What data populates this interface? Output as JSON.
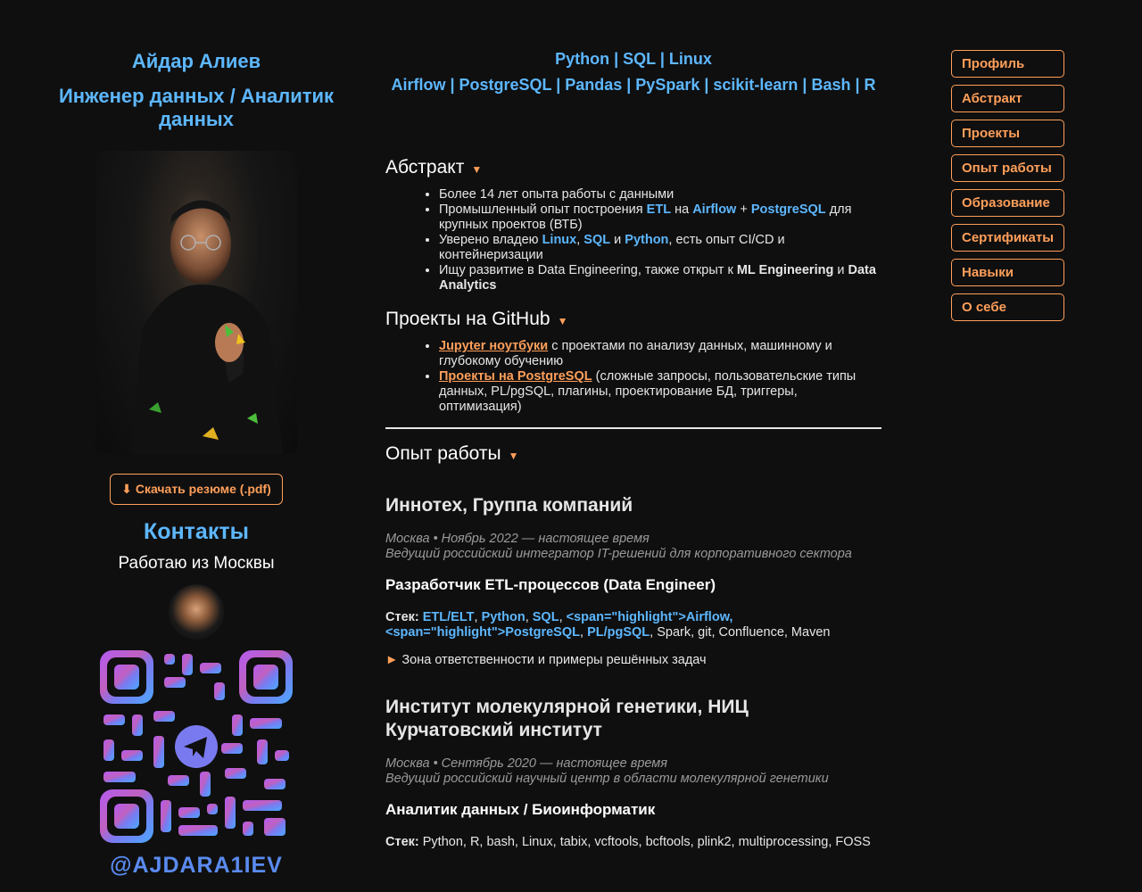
{
  "profile": {
    "name": "Айдар Алиев",
    "role": "Инженер данных / Аналитик данных",
    "resume_button": "⬇ Скачать резюме (.pdf)",
    "contacts_title": "Контакты",
    "location": "Работаю из Москвы",
    "telegram_handle": "@AJDARA1IEV"
  },
  "tech": {
    "line1": "Python | SQL | Linux",
    "line2": "Airflow | PostgreSQL | Pandas | PySpark | scikit-learn | Bash | R"
  },
  "sections": {
    "abstract_title": "Абстракт",
    "projects_title": "Проекты на GitHub",
    "experience_title": "Опыт работы",
    "caret": "▼"
  },
  "abstract": {
    "b1": "Более 14 лет опыта работы с данными",
    "b2_pre": "Промышленный опыт построения ",
    "b2_etl": "ETL",
    "b2_mid1": " на ",
    "b2_airflow": "Airflow",
    "b2_plus": " + ",
    "b2_pg": "PostgreSQL",
    "b2_post": " для крупных проектов (ВТБ)",
    "b3_pre": "Уверено владею ",
    "b3_linux": "Linux",
    "b3_c1": ", ",
    "b3_sql": "SQL",
    "b3_and": " и ",
    "b3_python": "Python",
    "b3_post": ", есть опыт CI/CD и контейнеризации",
    "b4_pre": "Ищу развитие в Data Engineering, также открыт к ",
    "b4_ml": "ML Engineering",
    "b4_and": " и ",
    "b4_da": "Data Analytics"
  },
  "projects": {
    "p1_link": "Jupyter ноутбуки",
    "p1_text": " с проектами по анализу данных, машинному и глубокому обучению",
    "p2_link": "Проекты на PostgreSQL",
    "p2_text": " (сложные запросы, пользовательские типы данных, PL/pgSQL, плагины, проектирование БД, триггеры, оптимизация)"
  },
  "jobs": [
    {
      "company": "Иннотех, Группа компаний",
      "meta1": "Москва • Ноябрь 2022 — настоящее время",
      "meta2": "Ведущий российский интегратор IT-решений для корпоративного сектора",
      "position": "Разработчик ETL-процессов (Data Engineer)",
      "stack_label": "Стек:",
      "stack_hl1": "ETL/ELT",
      "stack_c1": ", ",
      "stack_hl2": "Python",
      "stack_c2": ", ",
      "stack_hl3": "SQL",
      "stack_c3": ", ",
      "stack_hl4": "<span=\"highlight\">Airflow, <span=\"highlight\">PostgreSQL",
      "stack_c4": ", ",
      "stack_hl5": "PL/pgSQL",
      "stack_rest": ", Spark, git, Confluence, Maven",
      "toggle": "Зона ответственности и примеры решённых задач"
    },
    {
      "company": "Институт молекулярной генетики, НИЦ Курчатовский институт",
      "meta1": "Москва • Сентябрь 2020 — настоящее время",
      "meta2": "Ведущий российский научный центр в области молекулярной генетики",
      "position": "Аналитик данных / Биоинформатик",
      "stack_label": "Стек:",
      "stack_rest": " Python, R, bash, Linux, tabix, vcftools, bcftools, plink2, multiprocessing, FOSS"
    }
  ],
  "nav": [
    "Профиль",
    "Абстракт",
    "Проекты",
    "Опыт работы",
    "Образование",
    "Сертификаты",
    "Навыки",
    "О себе"
  ],
  "colors": {
    "accent_blue": "#5db7ff",
    "accent_orange": "#ff9f5a",
    "background": "#0f0f0f"
  },
  "icons": {
    "resume": "download-arrow",
    "qr_center": "telegram-icon"
  }
}
